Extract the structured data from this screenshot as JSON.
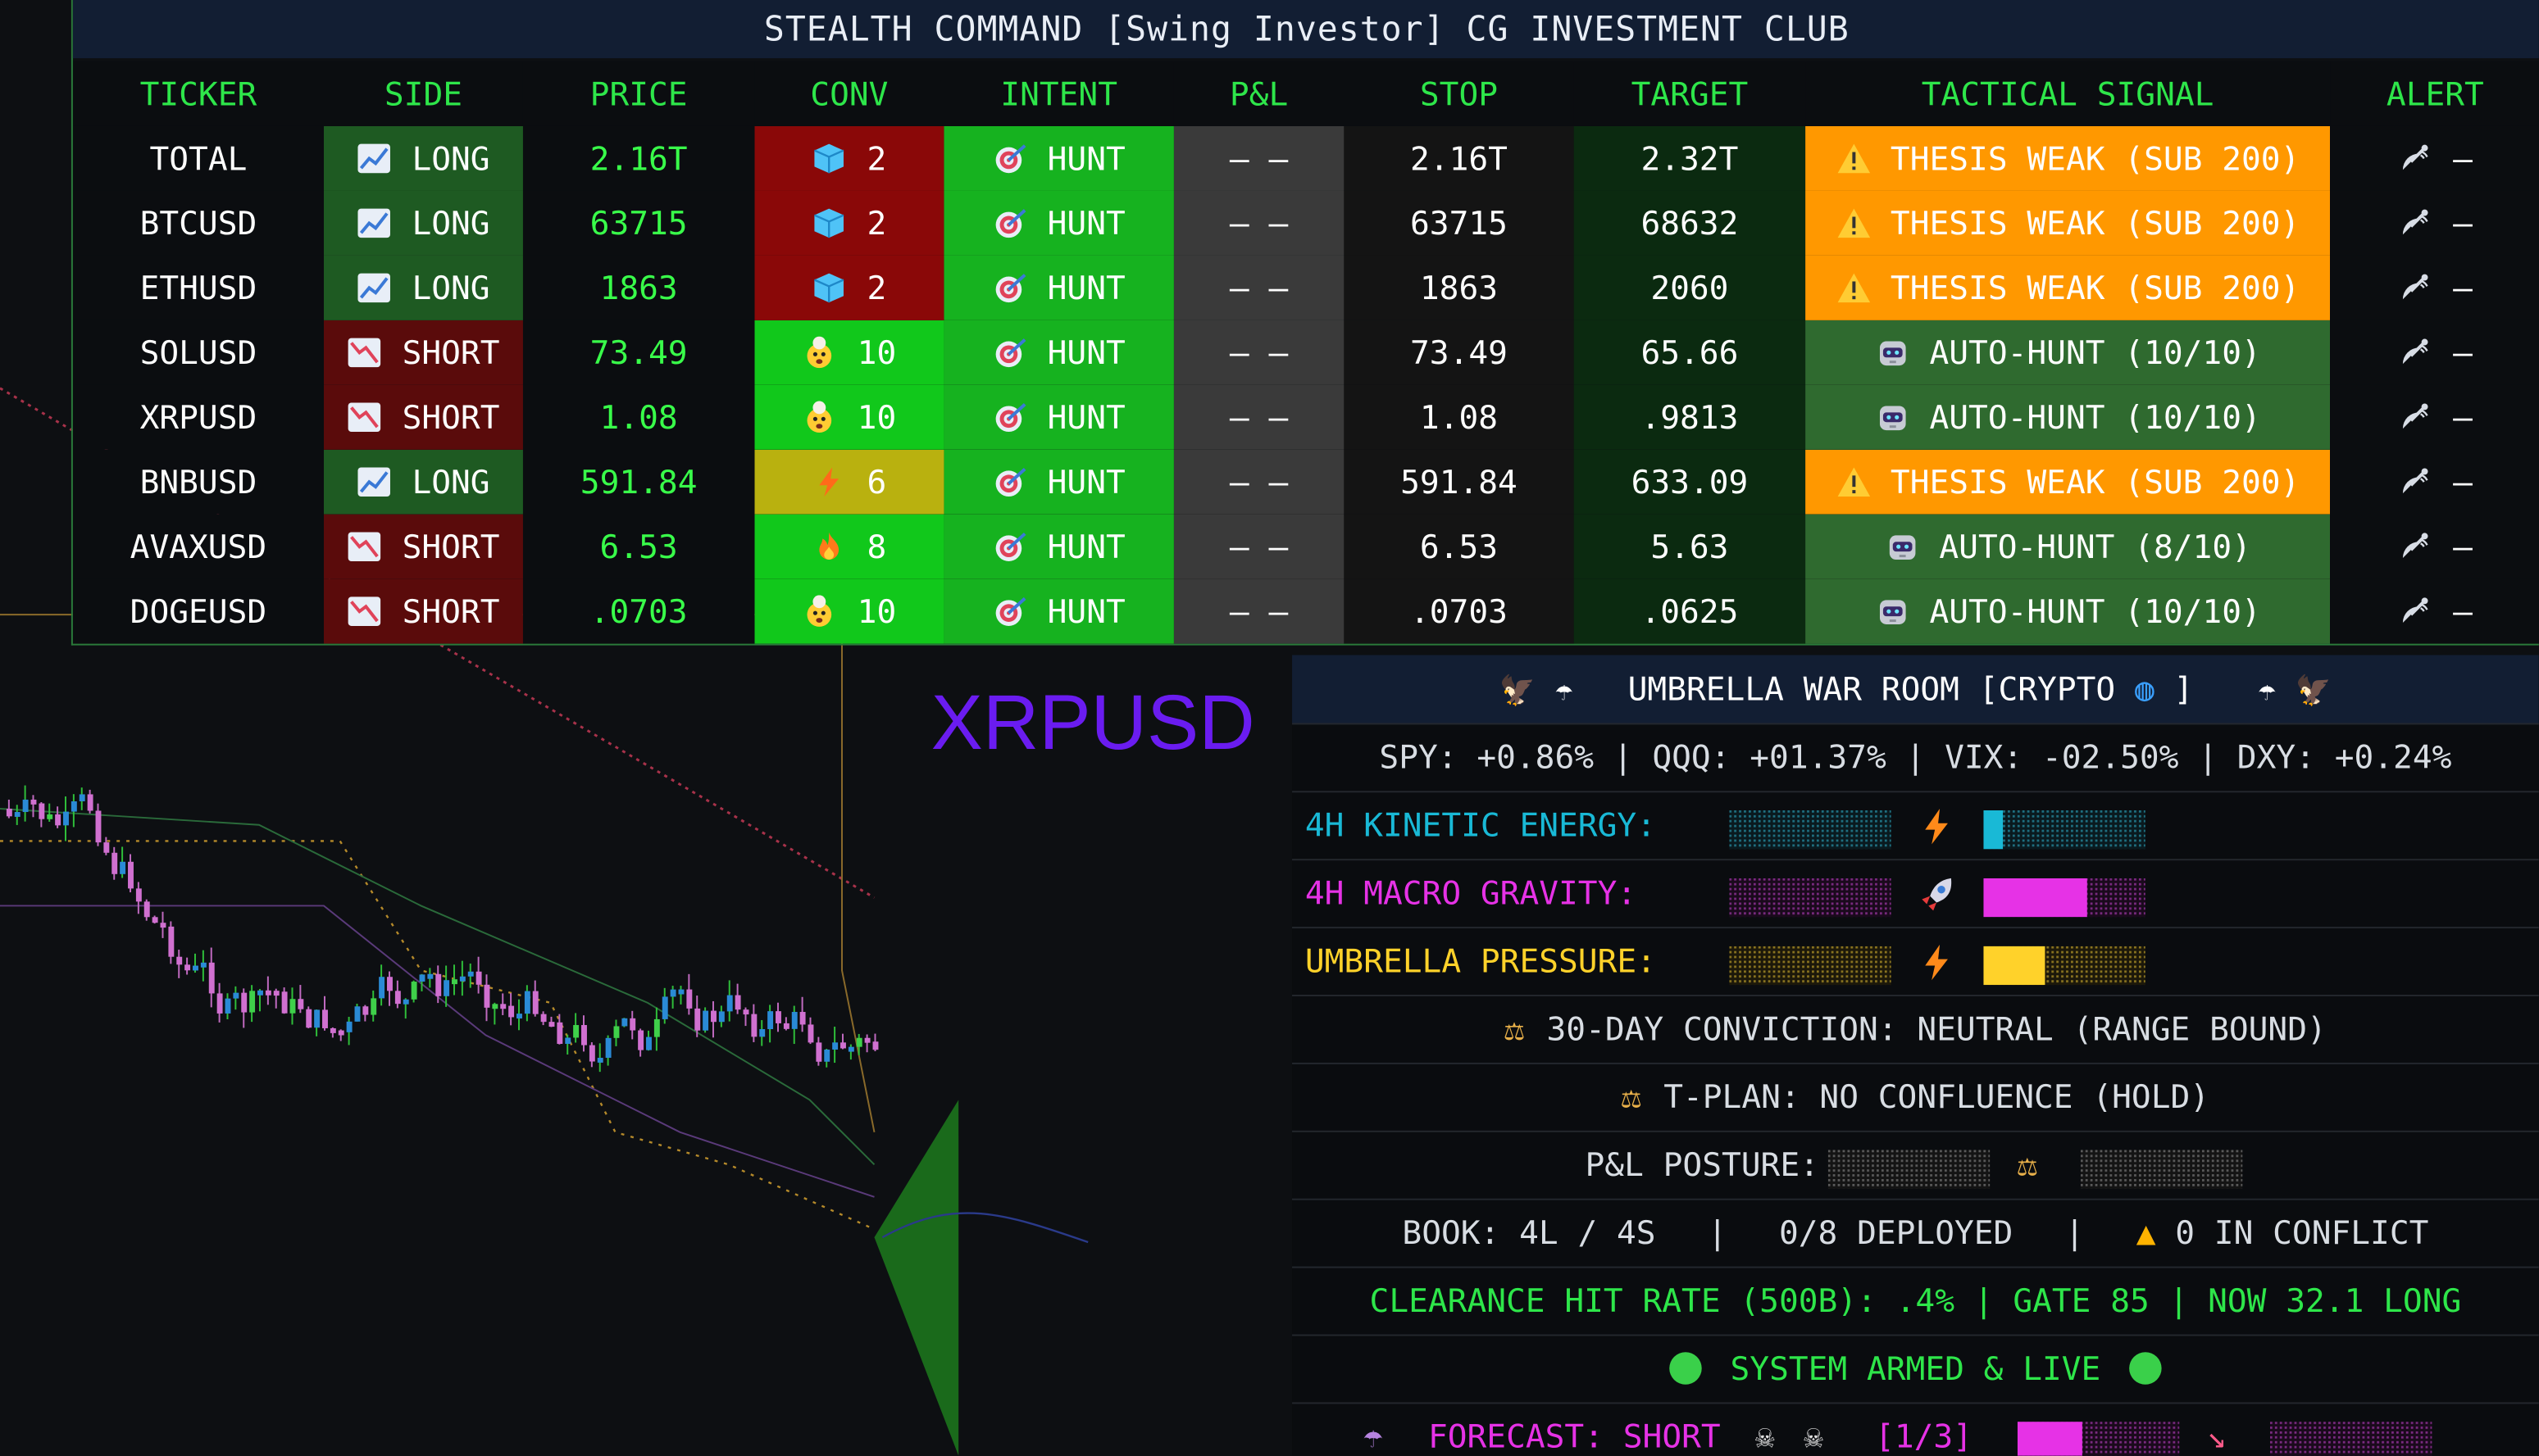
{
  "command": {
    "title": "STEALTH COMMAND [Swing Investor] CG INVESTMENT CLUB",
    "headers": [
      "TICKER",
      "SIDE",
      "PRICE",
      "CONV",
      "INTENT",
      "P&L",
      "STOP",
      "TARGET",
      "TACTICAL SIGNAL",
      "ALERT"
    ],
    "rows": [
      {
        "ticker": "TOTAL",
        "side": "LONG",
        "price": "2.16T",
        "conv": "2",
        "conv_icon": "cube-icon",
        "intent": "HUNT",
        "pnl": "— —",
        "stop": "2.16T",
        "target": "2.32T",
        "signal": "THESIS WEAK (SUB 200)",
        "signal_icon": "warning-icon",
        "alert": "—"
      },
      {
        "ticker": "BTCUSD",
        "side": "LONG",
        "price": "63715",
        "conv": "2",
        "conv_icon": "cube-icon",
        "intent": "HUNT",
        "pnl": "— —",
        "stop": "63715",
        "target": "68632",
        "signal": "THESIS WEAK (SUB 200)",
        "signal_icon": "warning-icon",
        "alert": "—"
      },
      {
        "ticker": "ETHUSD",
        "side": "LONG",
        "price": "1863",
        "conv": "2",
        "conv_icon": "cube-icon",
        "intent": "HUNT",
        "pnl": "— —",
        "stop": "1863",
        "target": "2060",
        "signal": "THESIS WEAK (SUB 200)",
        "signal_icon": "warning-icon",
        "alert": "—"
      },
      {
        "ticker": "SOLUSD",
        "side": "SHORT",
        "price": "73.49",
        "conv": "10",
        "conv_icon": "mind-blown-icon",
        "intent": "HUNT",
        "pnl": "— —",
        "stop": "73.49",
        "target": "65.66",
        "signal": "AUTO-HUNT (10/10)",
        "signal_icon": "robot-icon",
        "alert": "—"
      },
      {
        "ticker": "XRPUSD",
        "side": "SHORT",
        "price": "1.08",
        "conv": "10",
        "conv_icon": "mind-blown-icon",
        "intent": "HUNT",
        "pnl": "— —",
        "stop": "1.08",
        "target": ".9813",
        "signal": "AUTO-HUNT (10/10)",
        "signal_icon": "robot-icon",
        "alert": "—"
      },
      {
        "ticker": "BNBUSD",
        "side": "LONG",
        "price": "591.84",
        "conv": "6",
        "conv_icon": "bolt-icon",
        "intent": "HUNT",
        "pnl": "— —",
        "stop": "591.84",
        "target": "633.09",
        "signal": "THESIS WEAK (SUB 200)",
        "signal_icon": "warning-icon",
        "alert": "—"
      },
      {
        "ticker": "AVAXUSD",
        "side": "SHORT",
        "price": "6.53",
        "conv": "8",
        "conv_icon": "fire-icon",
        "intent": "HUNT",
        "pnl": "— —",
        "stop": "6.53",
        "target": "5.63",
        "signal": "AUTO-HUNT (8/10)",
        "signal_icon": "robot-icon",
        "alert": "—"
      },
      {
        "ticker": "DOGEUSD",
        "side": "SHORT",
        "price": ".0703",
        "conv": "10",
        "conv_icon": "mind-blown-icon",
        "intent": "HUNT",
        "pnl": "— —",
        "stop": ".0703",
        "target": ".0625",
        "signal": "AUTO-HUNT (10/10)",
        "signal_icon": "robot-icon",
        "alert": "—"
      }
    ]
  },
  "symbol_label": "XRPUSD",
  "war_room": {
    "title": "UMBRELLA WAR ROOM [CRYPTO",
    "title_end": "]",
    "macro": "SPY: +0.86% | QQQ: +01.37% | VIX: -02.50% | DXY: +0.24%",
    "kinetic": {
      "label": "4H KINETIC ENERGY:",
      "level": 0.12,
      "color": "#19b9d6"
    },
    "gravity": {
      "label": "4H MACRO GRAVITY:",
      "level": 0.64,
      "color": "#e632e6"
    },
    "pressure": {
      "label": "UMBRELLA PRESSURE:",
      "level": 0.38,
      "color": "#ffd22a"
    },
    "conviction": "30-DAY CONVICTION: NEUTRAL (RANGE BOUND)",
    "tplan": "T-PLAN: NO CONFLUENCE (HOLD)",
    "posture": "P&L POSTURE:",
    "book_a": "BOOK: 4L / 4S",
    "book_sep": "|",
    "book_b": "0/8 DEPLOYED",
    "book_c": "0 IN CONFLICT",
    "clearance": "CLEARANCE HIT RATE (500B): .4%  |  GATE 85  |  NOW 32.1 LONG",
    "system": "SYSTEM ARMED & LIVE",
    "forecast": "FORECAST: SHORT",
    "forecast_count": "[1/3]",
    "forecast_level": 0.4,
    "colors": {
      "cyan": "#19b9d6",
      "magenta": "#e632e6",
      "yellow": "#ffd22a",
      "green": "#2ee64a"
    }
  }
}
